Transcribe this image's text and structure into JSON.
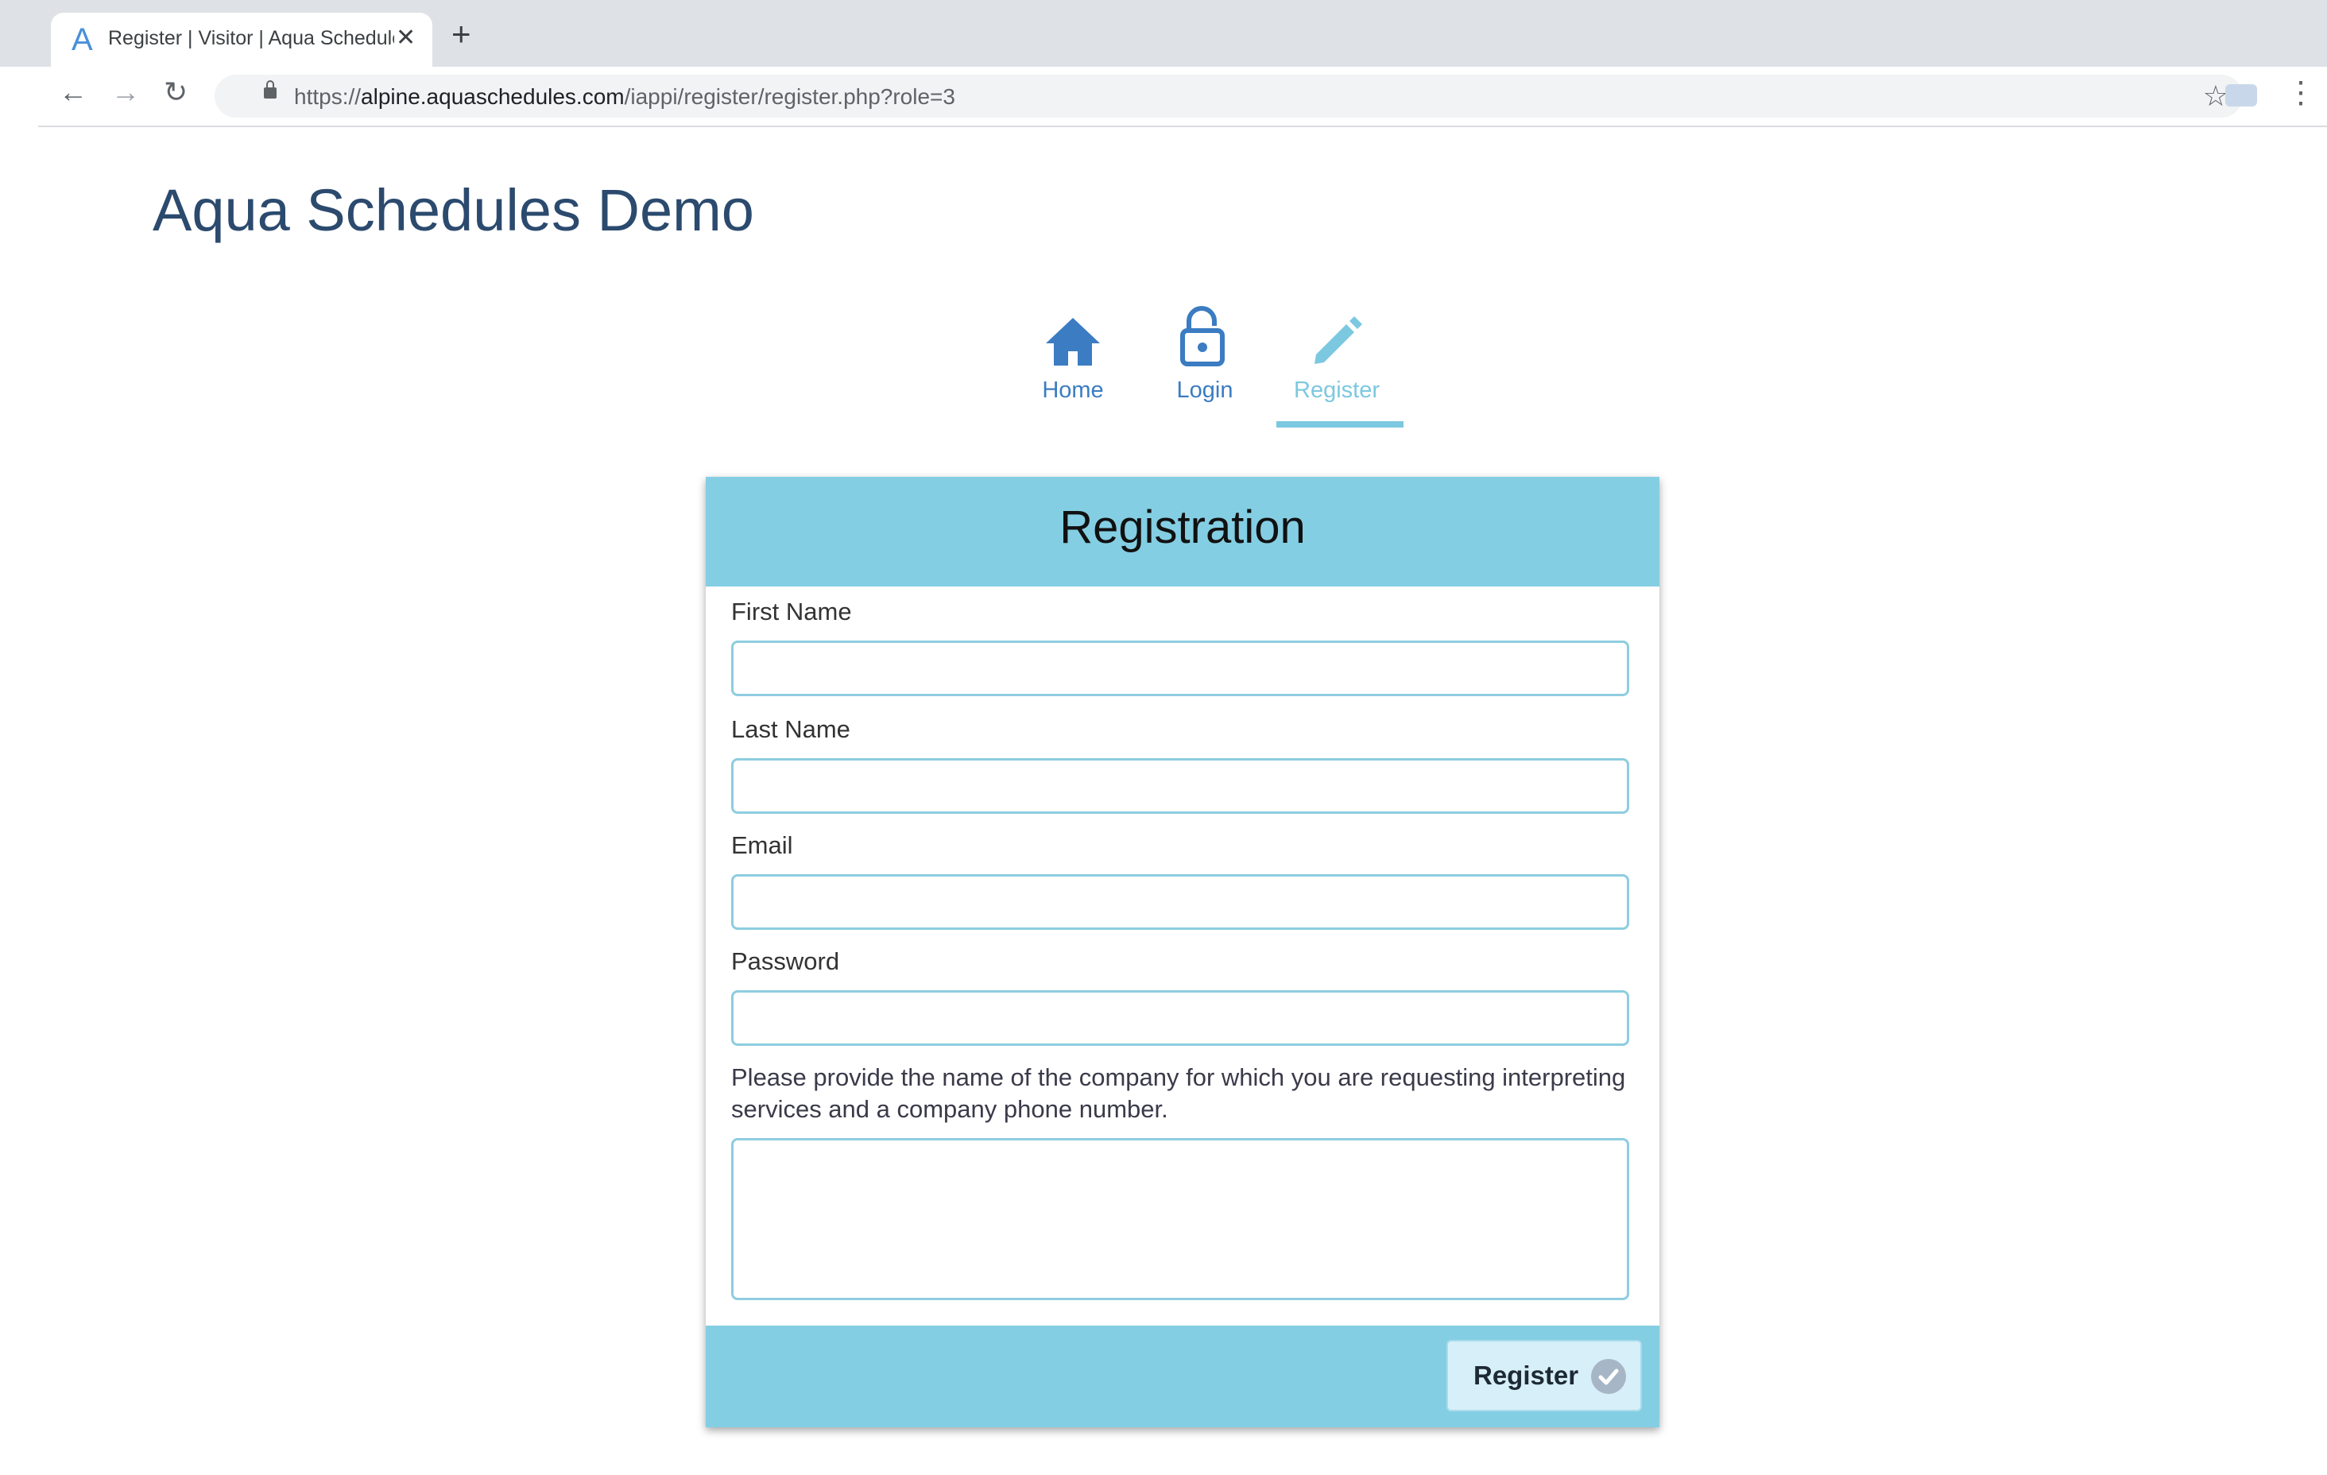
{
  "browser": {
    "tab_title": "Register | Visitor | Aqua Schedules Demo",
    "tab_favicon": "A",
    "new_tab_label": "+",
    "close_tab_label": "✕",
    "url_scheme": "https://",
    "url_host": "alpine.aquaschedules.com",
    "url_path": "/iappi/register/register.php?role=3"
  },
  "site": {
    "title": "Aqua Schedules Demo"
  },
  "nav": {
    "items": [
      {
        "label": "Home",
        "icon": "home-icon"
      },
      {
        "label": "Login",
        "icon": "lock-icon"
      },
      {
        "label": "Register",
        "icon": "pencil-icon",
        "active": true
      }
    ]
  },
  "form": {
    "title": "Registration",
    "first_name_label": "First Name",
    "first_name_value": "",
    "last_name_label": "Last Name",
    "last_name_value": "",
    "email_label": "Email",
    "email_value": "",
    "password_label": "Password",
    "password_value": "",
    "company_help": "Please provide the name of the company for which you are requesting interpreting services and a company phone number.",
    "company_value": "",
    "submit_label": "Register"
  },
  "colors": {
    "accent": "#84cee3",
    "nav_blue": "#3b7cc2",
    "nav_active": "#7cc8e0",
    "title_text": "#2b4a6e"
  }
}
